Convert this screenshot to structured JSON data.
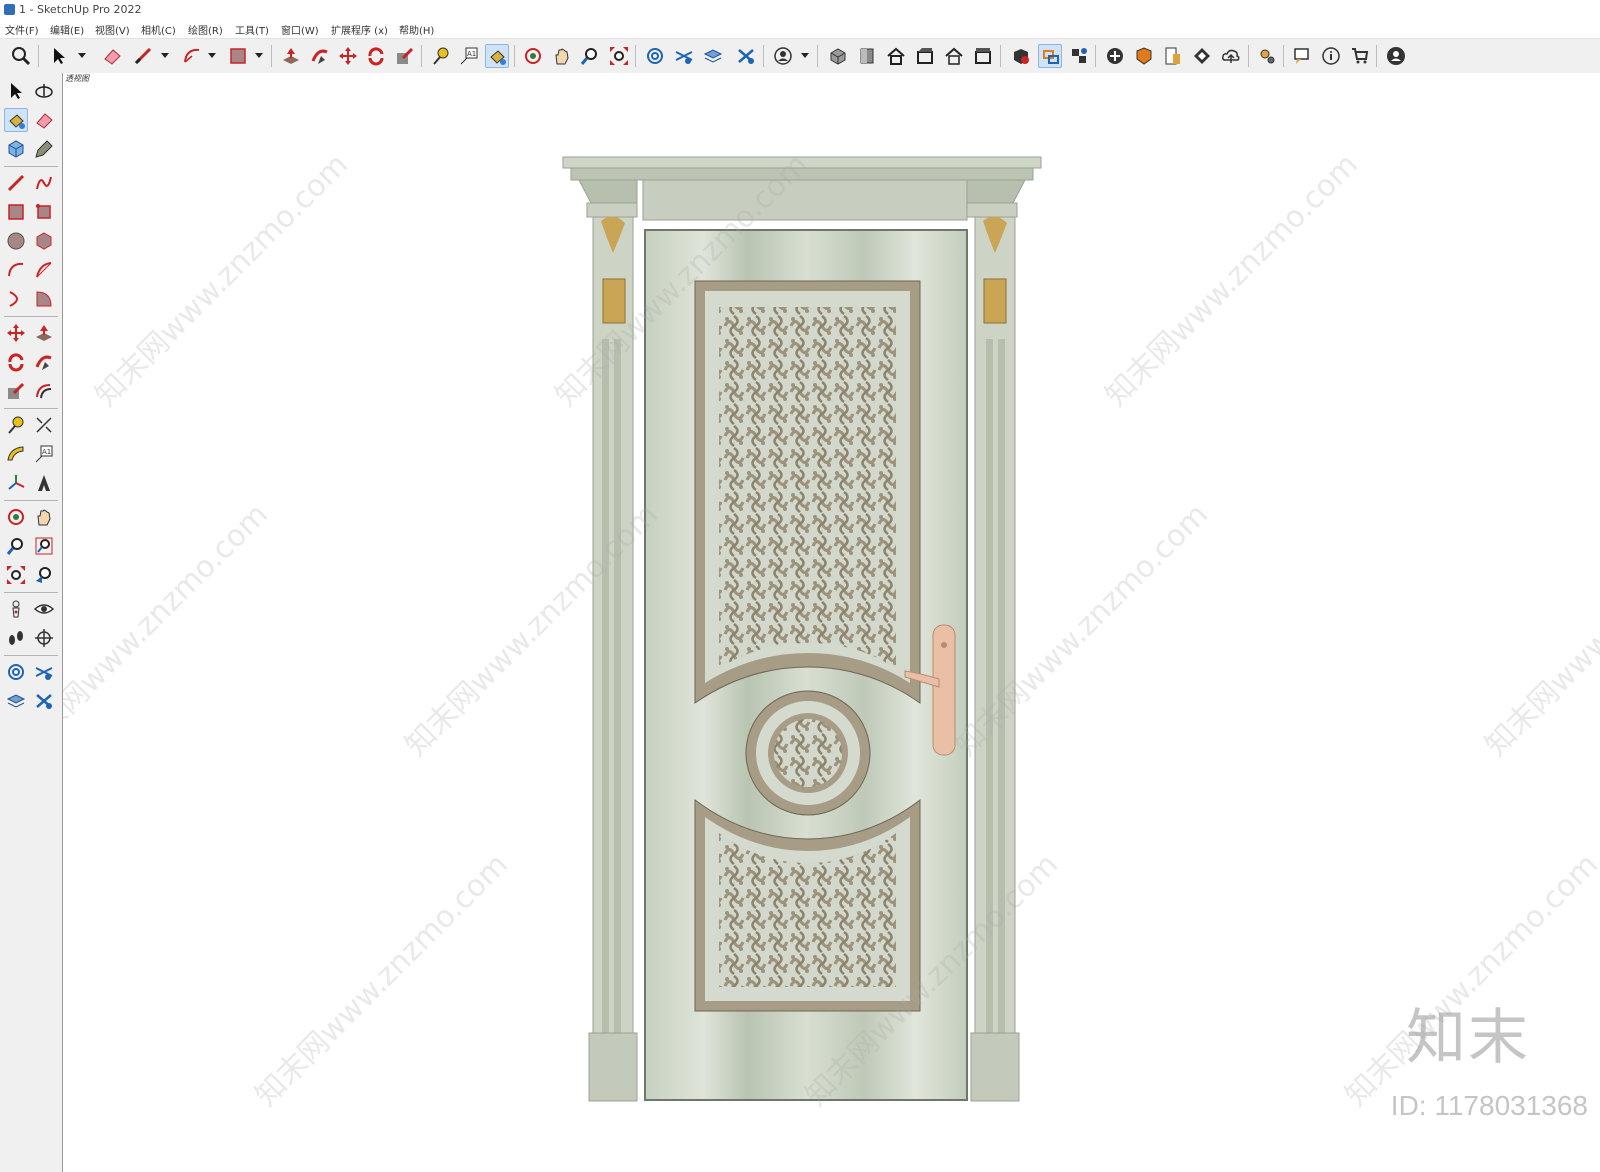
{
  "window": {
    "title": "1 - SketchUp Pro 2022"
  },
  "menu": {
    "items": [
      {
        "label": "文件(F)"
      },
      {
        "label": "编辑(E)"
      },
      {
        "label": "视图(V)"
      },
      {
        "label": "相机(C)"
      },
      {
        "label": "绘图(R)"
      },
      {
        "label": "工具(T)"
      },
      {
        "label": "窗口(W)"
      },
      {
        "label": "扩展程序 (x)"
      },
      {
        "label": "帮助(H)"
      }
    ]
  },
  "toolbar": {
    "icons": [
      "zoom-icon",
      "select-icon",
      "eraser-icon",
      "line-icon",
      "arc-icon",
      "rectangle-icon",
      "push-pull-icon",
      "follow-me-icon",
      "move-icon",
      "rotate-icon",
      "scale-icon",
      "tape-measure-icon",
      "text-icon",
      "paint-bucket-icon",
      "orbit-icon",
      "pan-icon",
      "zoom-window-icon",
      "zoom-extents-icon",
      "sandbox-icon",
      "styles-icon",
      "layers-icon",
      "components-icon",
      "user-icon",
      "iso-view-icon",
      "top-view-icon",
      "front-view-icon",
      "right-view-icon",
      "back-view-icon",
      "left-view-icon",
      "extension-warehouse-icon",
      "section-icon",
      "dynamic-component-icon",
      "add-location-icon",
      "shadow-icon",
      "report-icon",
      "texture-icon",
      "upload-icon",
      "settings-icon",
      "chat-icon",
      "info-icon",
      "cart-icon",
      "account-icon"
    ],
    "active": "paint-bucket-icon"
  },
  "left_toolbar": {
    "icons": [
      "select-icon",
      "orbit-icon",
      "paint-bucket-icon",
      "eraser-icon",
      "make-component-icon",
      "tag-icon",
      "line-icon",
      "freehand-icon",
      "rectangle-icon",
      "rotated-rectangle-icon",
      "circle-icon",
      "polygon-icon",
      "arc-icon",
      "two-point-arc-icon",
      "three-point-arc-icon",
      "pie-icon",
      "move-icon",
      "push-pull-icon",
      "rotate-icon",
      "follow-me-icon",
      "scale-icon",
      "offset-icon",
      "tape-measure-icon",
      "dimension-icon",
      "protractor-icon",
      "text-icon",
      "axes-icon",
      "3d-text-icon",
      "orbit-tool-icon",
      "pan-icon",
      "zoom-icon",
      "zoom-window-icon",
      "zoom-extents-icon",
      "previous-view-icon",
      "position-camera-icon",
      "look-around-icon",
      "walk-icon",
      "section-plane-icon",
      "styles-icon",
      "layers-icon",
      "outliner-icon",
      "components-icon"
    ],
    "active": "paint-bucket-icon"
  },
  "viewport": {
    "scene_label": "透视图",
    "watermark_text": "知末网www.znzmo.com",
    "brand_logo": "知末",
    "brand_id": "ID: 1178031368"
  },
  "colors": {
    "door_base": "#c9d2c3",
    "carving": "#9d927b",
    "handle": "#e9bfa6",
    "gilding": "#c9a555"
  }
}
